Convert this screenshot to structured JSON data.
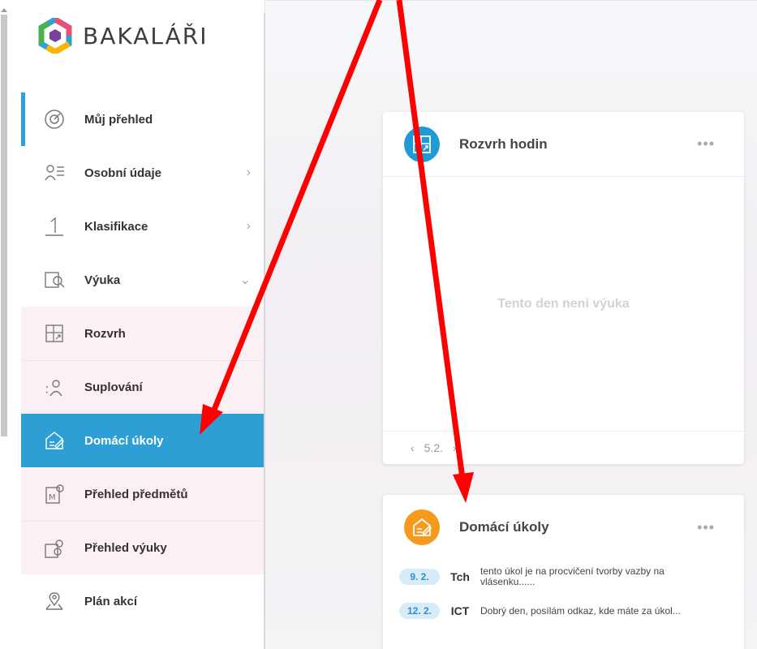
{
  "app": {
    "brand": "BAKALÁŘI"
  },
  "colors": {
    "accent": "#2e9fd4",
    "schedule_icon": "#1e9ad6",
    "homework_icon": "#f59a1c",
    "arrow": "#ff0000"
  },
  "sidebar": {
    "items": [
      {
        "label": "Můj přehled",
        "icon": "dashboard-icon",
        "chevron": ""
      },
      {
        "label": "Osobní údaje",
        "icon": "personal-data-icon",
        "chevron": "›"
      },
      {
        "label": "Klasifikace",
        "icon": "grade-icon",
        "chevron": "›"
      },
      {
        "label": "Výuka",
        "icon": "teaching-icon",
        "chevron": "⌄"
      },
      {
        "label": "Rozvrh",
        "icon": "timetable-icon",
        "chevron": ""
      },
      {
        "label": "Suplování",
        "icon": "substitution-icon",
        "chevron": ""
      },
      {
        "label": "Domácí úkoly",
        "icon": "homework-icon",
        "chevron": ""
      },
      {
        "label": "Přehled předmětů",
        "icon": "subjects-icon",
        "chevron": ""
      },
      {
        "label": "Přehled výuky",
        "icon": "teaching-overview-icon",
        "chevron": ""
      },
      {
        "label": "Plán akcí",
        "icon": "events-icon",
        "chevron": ""
      }
    ]
  },
  "main": {
    "schedule_card": {
      "title": "Rozvrh hodin",
      "more": "•••",
      "empty_message": "Tento den není výuka",
      "pager_prev": "‹",
      "pager_date": "5.2.",
      "pager_next": "›"
    },
    "homework_card": {
      "title": "Domácí úkoly",
      "more": "•••",
      "rows": [
        {
          "date": "9. 2.",
          "subject": "Tch",
          "text": "tento úkol je na procvičení tvorby vazby na vlásenku......"
        },
        {
          "date": "12. 2.",
          "subject": "ICT",
          "text": "Dobrý den, posílám odkaz, kde máte za úkol..."
        }
      ]
    }
  }
}
